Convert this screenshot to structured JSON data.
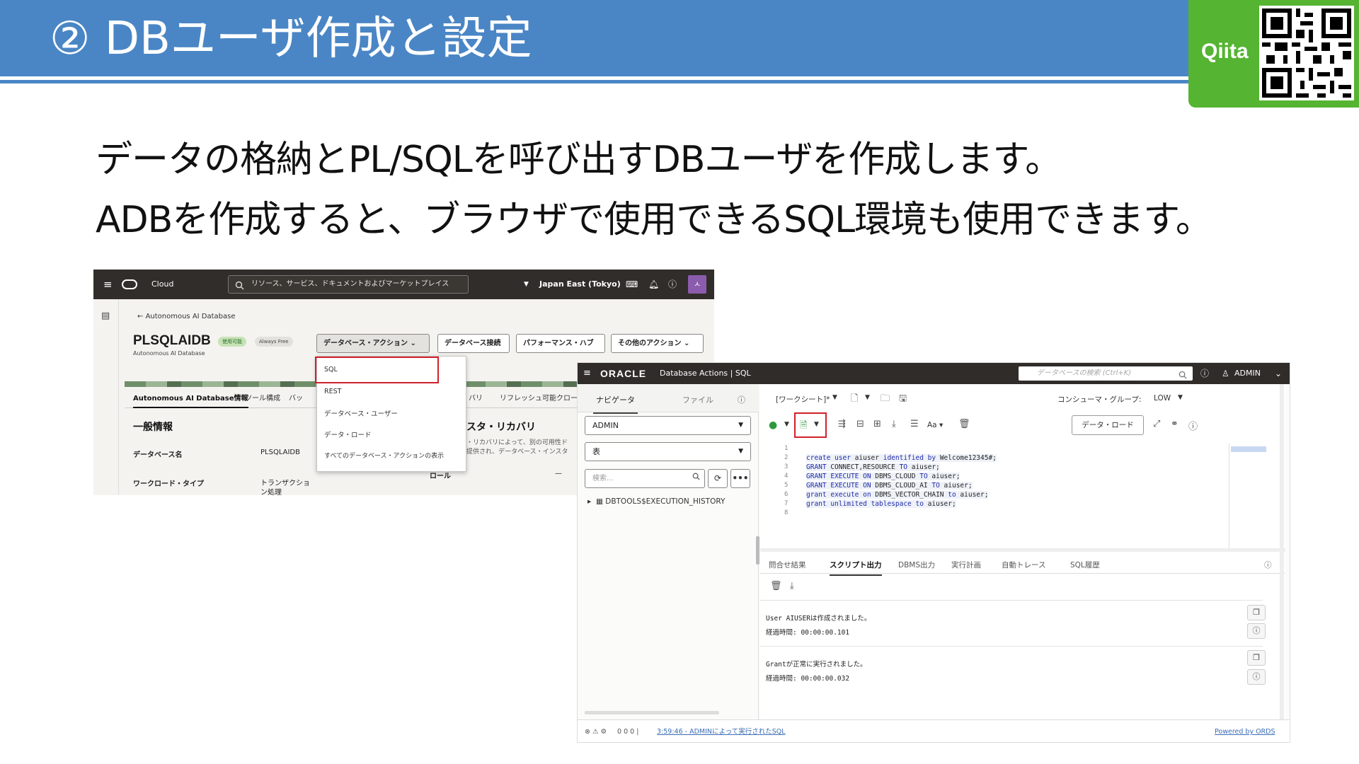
{
  "slide": {
    "title": "② DBユーザ作成と設定",
    "badge": "Qiita",
    "line1": "データの格納とPL/SQLを呼び出すDBユーザを作成します。",
    "line2": "ADBを作成すると、ブラウザで使用できるSQL環境も使用できます。"
  },
  "colors": {
    "banner": "#4a86c5",
    "qiita_green": "#55b432",
    "highlight_red": "#d0202a"
  },
  "oci": {
    "brand": "Cloud",
    "search_placeholder": "リソース、サービス、ドキュメントおよびマーケットプレイス",
    "region": "Japan East (Tokyo)",
    "breadcrumb": "Autonomous AI Database",
    "db_name": "PLSQLAIDB",
    "db_subtitle": "Autonomous AI Database",
    "status_badge": "使用可能",
    "tier_badge": "Always Free",
    "buttons": {
      "db_actions": "データベース・アクション",
      "db_connection": "データベース接続",
      "performance_hub": "パフォーマンス・ハブ",
      "more_actions": "その他のアクション"
    },
    "tabs": [
      "Autonomous AI Database情報",
      "ツール構成",
      "バッ",
      "バリ",
      "リフレッシュ可能クロー"
    ],
    "general_info": "一般情報",
    "db_name_label": "データベース名",
    "db_name_value": "PLSQLAIDB",
    "workload_label": "ワークロード・タイプ",
    "workload_value_1": "トランザクショ",
    "workload_value_2": "ン処理",
    "recovery_heading": "スタ・リカバリ",
    "recovery_text_1": "・リカバリによって、別の可用性ド",
    "recovery_text_2": "提供され、データベース・インスタ",
    "role_label": "ロール",
    "role_value": "—",
    "dropdown_items": [
      "SQL",
      "REST",
      "データベース・ユーザー",
      "データ・ロード",
      "すべてのデータベース・アクションの表示"
    ]
  },
  "sqlws": {
    "oracle_logo": "ORACLE",
    "title": "Database Actions | SQL",
    "search_placeholder": "データベースの検索 (Ctrl+K)",
    "user": "ADMIN",
    "nav_tab": "ナビゲータ",
    "file_tab": "ファイル",
    "schema": "ADMIN",
    "object_type": "表",
    "search_placeholder_nav": "検索...",
    "table_item": "DBTOOLS$EXECUTION_HISTORY",
    "worksheet": "[ワークシート]*",
    "consumer_group_label": "コンシューマ・グループ:",
    "consumer_group_value": "LOW",
    "data_load": "データ・ロード",
    "code_lines": [
      "create user aiuser identified by Welcome12345#;",
      "GRANT CONNECT,RESOURCE TO aiuser;",
      "GRANT EXECUTE ON DBMS_CLOUD TO aiuser;",
      "GRANT EXECUTE ON DBMS_CLOUD_AI TO aiuser;",
      "grant execute on DBMS_VECTOR_CHAIN to aiuser;",
      "grant unlimited tablespace to aiuser;",
      ""
    ],
    "line_numbers": [
      "1",
      "2",
      "3",
      "4",
      "5",
      "6",
      "7",
      "8"
    ],
    "output_tabs": [
      "問合せ結果",
      "スクリプト出力",
      "DBMS出力",
      "実行計画",
      "自動トレース",
      "SQL履歴"
    ],
    "output": [
      {
        "message": "User AIUSERは作成されました。",
        "elapsed": "経過時間: 00:00:00.101"
      },
      {
        "message": "Grantが正常に実行されました。",
        "elapsed": "経過時間: 00:00:00.032"
      }
    ],
    "status_counts": "0  0  0 |",
    "status_link": "3:59:46 - ADMINによって実行されたSQL",
    "powered_by": "Powered by ORDS"
  }
}
